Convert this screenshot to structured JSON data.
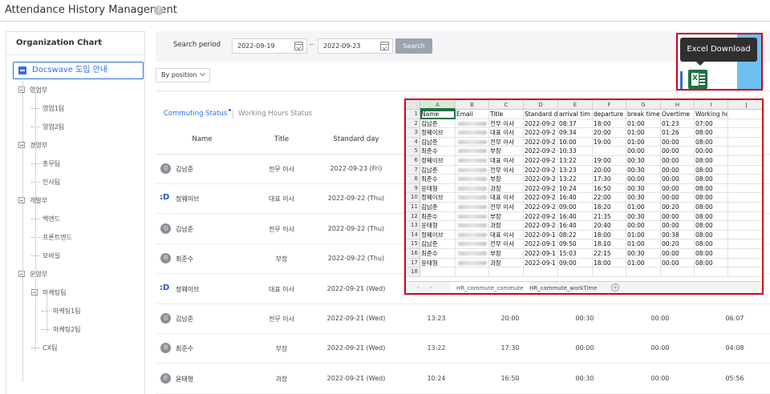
{
  "page": {
    "title": "Attendance History Management",
    "help_icon": "?"
  },
  "sidebar": {
    "header": "Organization Chart",
    "root": "Docswave 도입 안내",
    "nodes": [
      {
        "label": "영업부",
        "level": 1,
        "expandable": true
      },
      {
        "label": "영업1팀",
        "level": 2,
        "expandable": false
      },
      {
        "label": "영업2팀",
        "level": 2,
        "expandable": false
      },
      {
        "label": "경영부",
        "level": 1,
        "expandable": true
      },
      {
        "label": "총무팀",
        "level": 2,
        "expandable": false
      },
      {
        "label": "인사팀",
        "level": 2,
        "expandable": false
      },
      {
        "label": "개발부",
        "level": 1,
        "expandable": true
      },
      {
        "label": "백엔드",
        "level": 2,
        "expandable": false
      },
      {
        "label": "프론트엔드",
        "level": 2,
        "expandable": false
      },
      {
        "label": "모바일",
        "level": 2,
        "expandable": false
      },
      {
        "label": "운영부",
        "level": 1,
        "expandable": true
      },
      {
        "label": "마케팅팀",
        "level": 2,
        "expandable": true
      },
      {
        "label": "마케팅1팀",
        "level": 3,
        "expandable": false
      },
      {
        "label": "마케팅2팀",
        "level": 3,
        "expandable": false
      },
      {
        "label": "CX팀",
        "level": 2,
        "expandable": false
      }
    ]
  },
  "search": {
    "label": "Search period",
    "start_date": "2022-09-19",
    "end_date": "2022-09-23",
    "separator": "~",
    "button": "Search",
    "position_select": "By position"
  },
  "tabs": {
    "active": "Commuting Status",
    "inactive": "Working Hours Status"
  },
  "table": {
    "headers": {
      "name": "Name",
      "title": "Title",
      "day": "Standard day"
    },
    "rows": [
      {
        "avatar": "김",
        "name": "김남준",
        "title": "전무 이사",
        "day": "2022-09-23 (Fri)",
        "arrival": "",
        "departure": "",
        "break": "",
        "overtime": "",
        "hours": "",
        "logo": false
      },
      {
        "avatar": ":D",
        "name": "정웨이브",
        "title": "대표 이사",
        "day": "2022-09-22 (Thu)",
        "arrival": "",
        "departure": "",
        "break": "",
        "overtime": "",
        "hours": "",
        "logo": true
      },
      {
        "avatar": "김",
        "name": "김남준",
        "title": "전무 이사",
        "day": "2022-09-22 (Thu)",
        "arrival": "",
        "departure": "",
        "break": "",
        "overtime": "",
        "hours": "",
        "logo": false
      },
      {
        "avatar": "최",
        "name": "최준수",
        "title": "부장",
        "day": "2022-09-22 (Thu)",
        "arrival": "",
        "departure": "",
        "break": "",
        "overtime": "",
        "hours": "",
        "logo": false
      },
      {
        "avatar": ":D",
        "name": "정웨이브",
        "title": "대표 이사",
        "day": "2022-09-21 (Wed)",
        "arrival": "",
        "departure": "",
        "break": "",
        "overtime": "",
        "hours": "",
        "logo": true
      },
      {
        "avatar": "김",
        "name": "김남준",
        "title": "전무 이사",
        "day": "2022-09-21 (Wed)",
        "arrival": "13:23",
        "departure": "20:00",
        "break": "00:30",
        "overtime": "00:00",
        "hours": "06:07",
        "logo": false
      },
      {
        "avatar": "최",
        "name": "최준수",
        "title": "부장",
        "day": "2022-09-21 (Wed)",
        "arrival": "13:22",
        "departure": "17:30",
        "break": "00:00",
        "overtime": "00:00",
        "hours": "04:08",
        "logo": false
      },
      {
        "avatar": "윤",
        "name": "윤태형",
        "title": "과장",
        "day": "2022-09-21 (Wed)",
        "arrival": "10:24",
        "departure": "16:50",
        "break": "00:30",
        "overtime": "00:00",
        "hours": "05:56",
        "logo": false
      }
    ]
  },
  "excel": {
    "tooltip": "Excel Download"
  },
  "spreadsheet": {
    "columns": [
      "A",
      "B",
      "C",
      "D",
      "E",
      "F",
      "G",
      "H",
      "I",
      "J"
    ],
    "header_row": [
      "Name",
      "Email",
      "Title",
      "Standard d",
      "arrival tim",
      "departure",
      "break time",
      "Overtime",
      "Working hours",
      ""
    ],
    "rows": [
      [
        "김남준",
        "",
        "전무 이사",
        "2022-09-2",
        "08:37",
        "18:00",
        "01:00",
        "01:23",
        "07:00"
      ],
      [
        "정웨이브",
        "",
        "대표 이사",
        "2022-09-2",
        "09:34",
        "20:00",
        "01:00",
        "01:26",
        "08:00"
      ],
      [
        "김남준",
        "",
        "전무 이사",
        "2022-09-2",
        "10:00",
        "19:00",
        "01:00",
        "00:00",
        "08:00"
      ],
      [
        "최준수",
        "",
        "부장",
        "2022-09-2",
        "10:33",
        "",
        "00:00",
        "00:00",
        "00:00"
      ],
      [
        "정웨이브",
        "",
        "대표 이사",
        "2022-09-2",
        "13:22",
        "19:00",
        "00:30",
        "00:00",
        "08:00"
      ],
      [
        "김남준",
        "",
        "전무 이사",
        "2022-09-2",
        "13:23",
        "20:00",
        "00:30",
        "00:00",
        "08:00"
      ],
      [
        "최준수",
        "",
        "부장",
        "2022-09-2",
        "13:22",
        "17:30",
        "00:00",
        "00:00",
        "08:00"
      ],
      [
        "윤태형",
        "",
        "과장",
        "2022-09-2",
        "10:24",
        "16:50",
        "00:30",
        "00:00",
        "08:00"
      ],
      [
        "정웨이브",
        "",
        "대표 이사",
        "2022-09-2",
        "16:40",
        "22:00",
        "00:30",
        "00:00",
        "08:00"
      ],
      [
        "김남준",
        "",
        "전무 이사",
        "2022-09-2",
        "09:00",
        "18:20",
        "01:00",
        "00:20",
        "08:00"
      ],
      [
        "최준수",
        "",
        "부장",
        "2022-09-2",
        "16:40",
        "21:35",
        "00:30",
        "00:00",
        "08:00"
      ],
      [
        "윤태형",
        "",
        "과장",
        "2022-09-2",
        "16:40",
        "20:40",
        "00:00",
        "00:00",
        "08:00"
      ],
      [
        "정웨이브",
        "",
        "대표 이사",
        "2022-09-1",
        "08:22",
        "18:00",
        "01:00",
        "00:38",
        "08:00"
      ],
      [
        "김남준",
        "",
        "전무 이사",
        "2022-09-1",
        "09:50",
        "18:10",
        "01:00",
        "00:20",
        "08:00"
      ],
      [
        "최준수",
        "",
        "부장",
        "2022-09-1",
        "15:03",
        "22:15",
        "00:30",
        "00:00",
        "08:00"
      ],
      [
        "윤태형",
        "",
        "과장",
        "2022-09-1",
        "09:00",
        "18:00",
        "01:00",
        "00:00",
        "08:00"
      ]
    ],
    "row_numbers": [
      "1",
      "2",
      "3",
      "4",
      "5",
      "6",
      "7",
      "8",
      "9",
      "10",
      "11",
      "12",
      "13",
      "14",
      "15",
      "16",
      "17",
      "18"
    ],
    "sheet_tabs": [
      "HR_commute_commute",
      "HR_commute_workTime"
    ],
    "add_sheet": "+",
    "nav_prev": "‹",
    "nav_next": "›"
  }
}
